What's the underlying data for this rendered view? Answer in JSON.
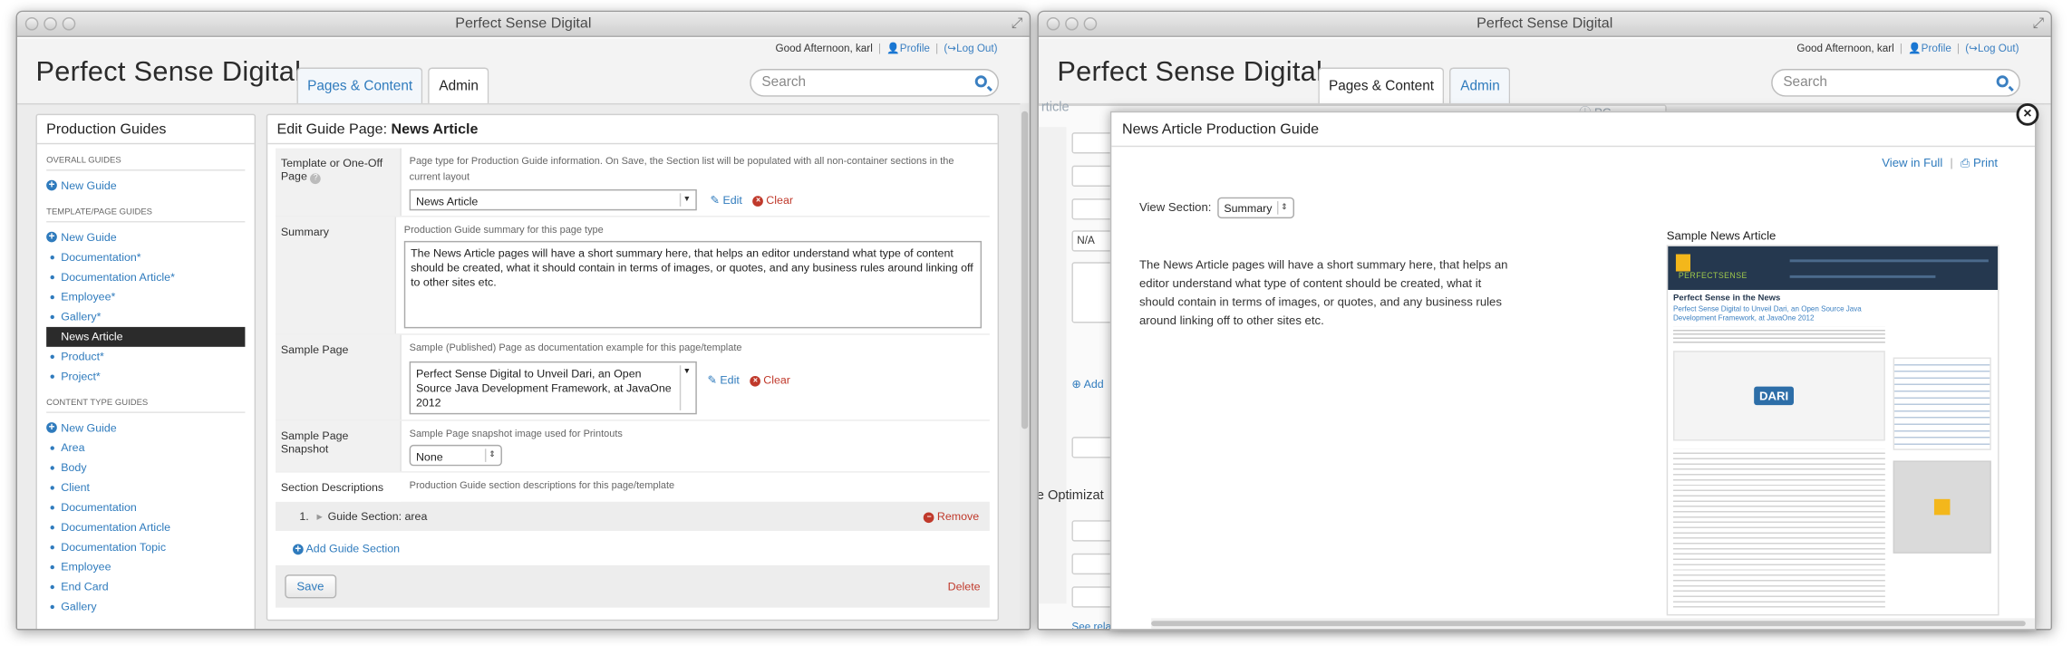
{
  "app": {
    "window_title": "Perfect Sense Digital",
    "greeting": "Good Afternoon, karl",
    "profile_link": "Profile",
    "logout_link": "Log Out",
    "brand": "Perfect Sense Digital",
    "tab_pages": "Pages & Content",
    "tab_admin": "Admin",
    "search_placeholder": "Search"
  },
  "sidebar": {
    "title": "Production Guides",
    "overall_header": "Overall Guides",
    "overall_items": [
      "New Guide"
    ],
    "template_header": "Template/Page Guides",
    "template_items": [
      "New Guide",
      "Documentation*",
      "Documentation Article*",
      "Employee*",
      "Gallery*",
      "News Article",
      "Product*",
      "Project*"
    ],
    "template_selected": "News Article",
    "content_header": "Content Type Guides",
    "content_items": [
      "New Guide",
      "Area",
      "Body",
      "Client",
      "Documentation",
      "Documentation Article",
      "Documentation Topic",
      "Employee",
      "End Card",
      "Gallery"
    ]
  },
  "editor": {
    "title_prefix": "Edit Guide Page:",
    "title_name": "News Article",
    "template_label": "Template or One-Off Page",
    "template_help": "Page type for Production Guide information. On Save, the Section list will be populated with all non-container sections in the current layout",
    "template_value": "News Article",
    "edit_label": "Edit",
    "clear_label": "Clear",
    "summary_label": "Summary",
    "summary_help": "Production Guide summary for this page type",
    "summary_value": "The News Article pages will have a short summary here, that helps an editor understand what type of content should be created, what it should contain in terms of images, or quotes, and any business rules around linking off to other sites etc.",
    "sample_label": "Sample Page",
    "sample_help": "Sample (Published) Page as documentation example for this page/template",
    "sample_value": "Perfect Sense Digital to Unveil Dari, an Open Source Java Development Framework, at JavaOne 2012",
    "snapshot_label": "Sample Page Snapshot",
    "snapshot_help": "Sample Page snapshot image used for Printouts",
    "snapshot_value": "None",
    "sections_label": "Section Descriptions",
    "sections_help": "Production Guide section descriptions for this page/template",
    "section_num": "1.",
    "section_name": "Guide Section: area",
    "remove_label": "Remove",
    "add_section": "Add Guide Section",
    "save": "Save",
    "delete": "Delete"
  },
  "right_bg": {
    "frag_article": "rticle",
    "frag_pg": "PG",
    "na_value": "N/A",
    "add_frag": "Add",
    "optim_frag": "ne Optimizat",
    "see_frag": "See rela"
  },
  "modal": {
    "title": "News Article Production Guide",
    "view_full": "View in Full",
    "print": "Print",
    "view_section_label": "View Section:",
    "view_section_value": "Summary",
    "summary_text": "The News Article pages will have a short summary here, that helps an editor understand what type of content should be created, what it should contain in terms of images, or quotes, and any business rules around linking off to other sites etc.",
    "sample_title": "Sample News Article",
    "thumb_logo": "PERFECTSENSE",
    "thumb_heading": "Perfect Sense in the News",
    "thumb_link": "Perfect Sense Digital to Unveil Dari, an Open Source Java Development Framework, at JavaOne 2012",
    "thumb_dari": "DARI"
  },
  "colors": {
    "link": "#2f7bbd",
    "danger": "#c0392b",
    "selected_bg": "#2b2b2b"
  }
}
